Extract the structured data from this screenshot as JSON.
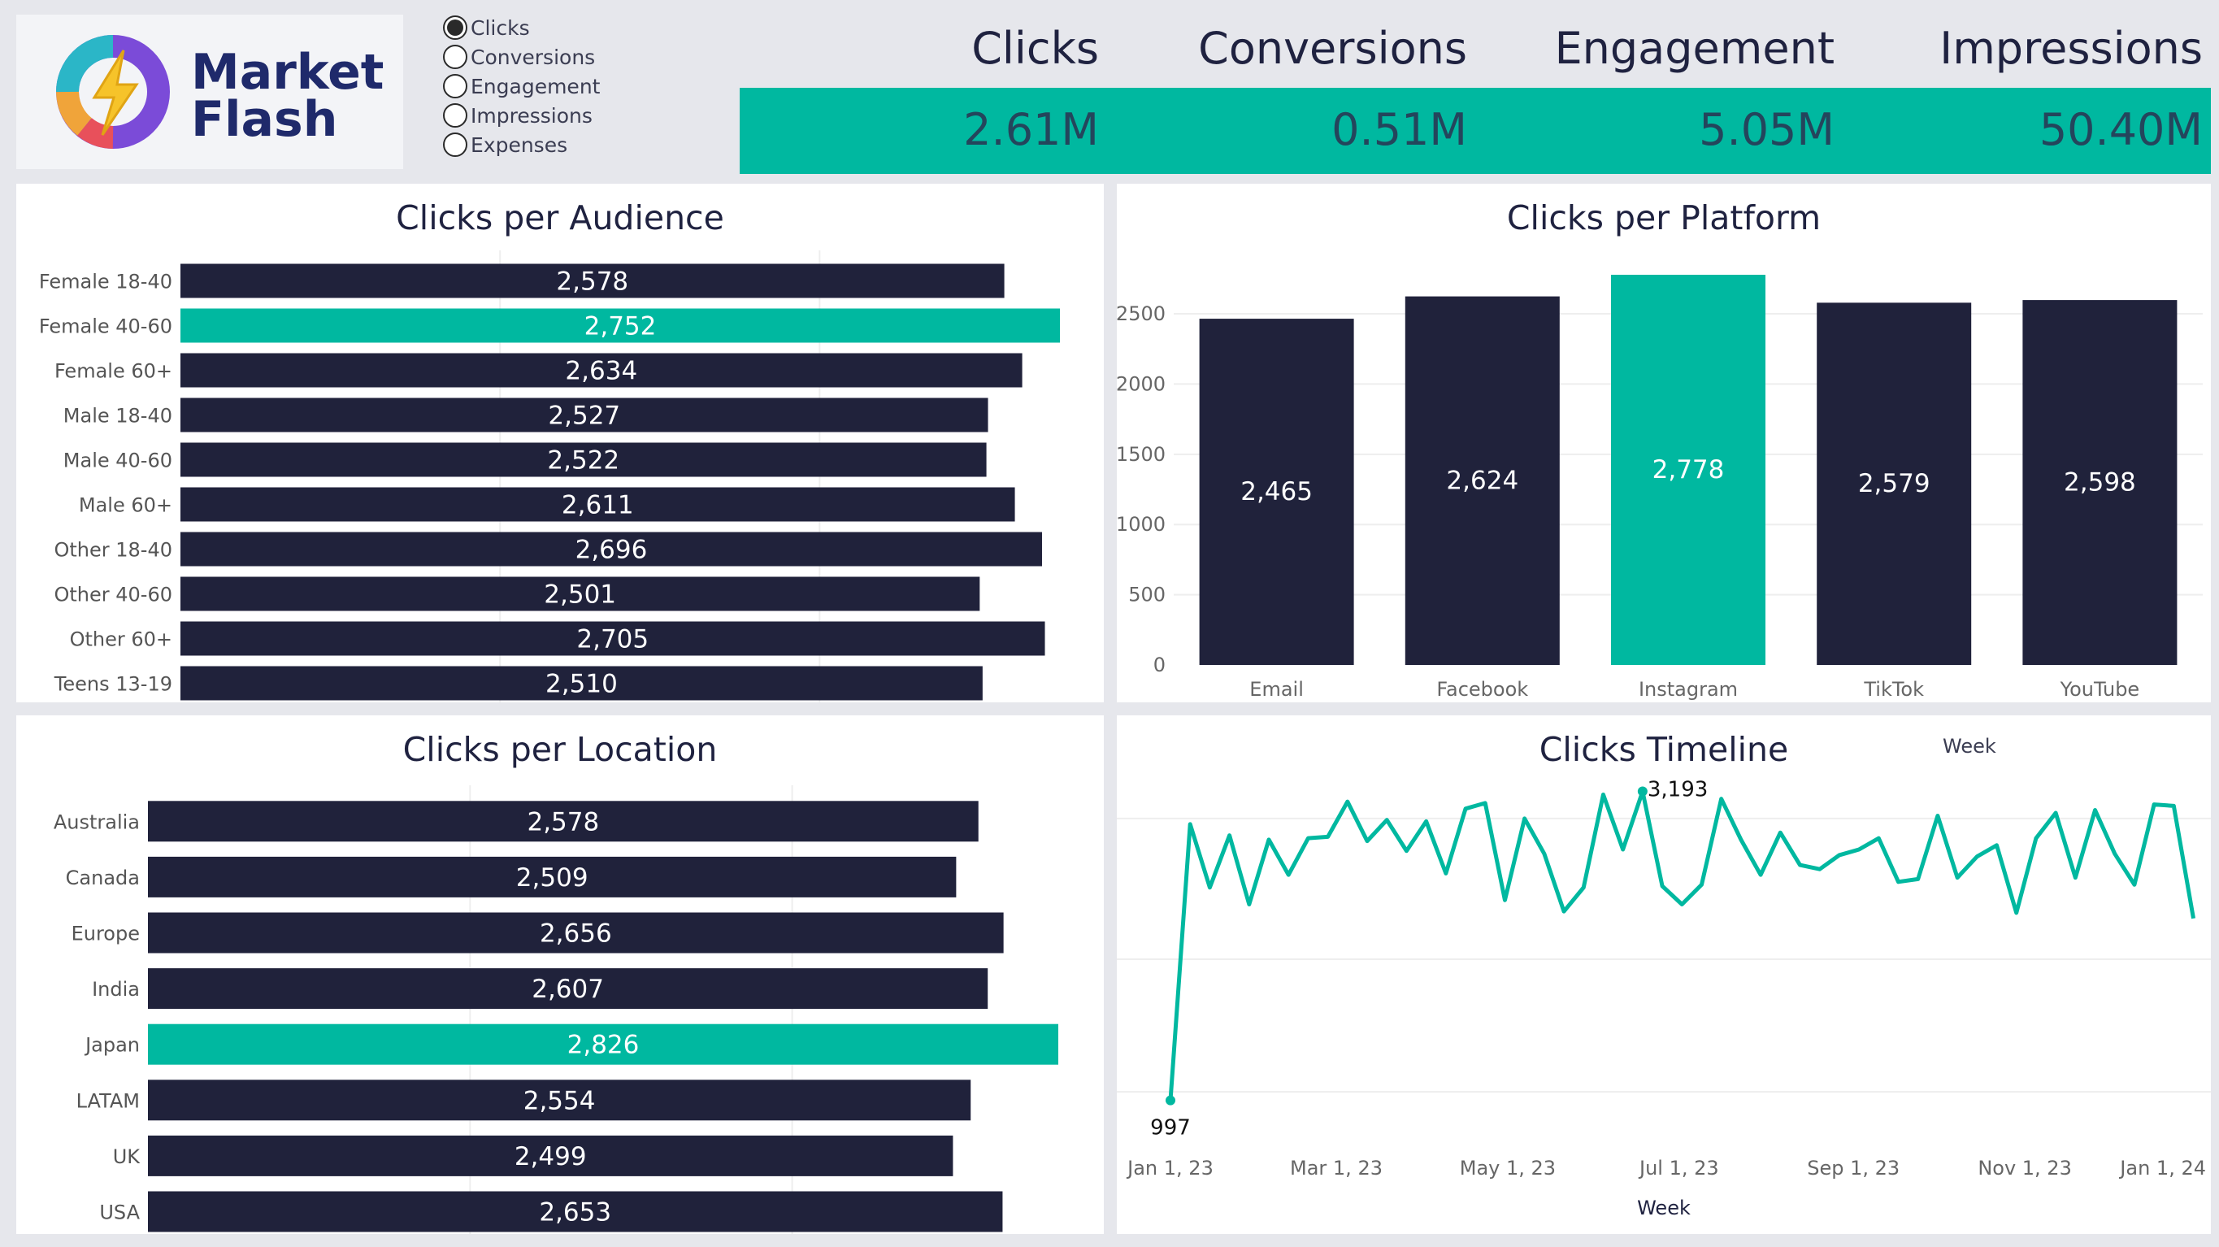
{
  "brand": {
    "line1": "Market",
    "line2": "Flash"
  },
  "metric_selector": {
    "options": [
      "Clicks",
      "Conversions",
      "Engagement",
      "Impressions",
      "Expenses"
    ],
    "selected": "Clicks"
  },
  "kpis": [
    {
      "label": "Clicks",
      "value": "2.61M"
    },
    {
      "label": "Conversions",
      "value": "0.51M"
    },
    {
      "label": "Engagement",
      "value": "5.05M"
    },
    {
      "label": "Impressions",
      "value": "50.40M"
    }
  ],
  "colors": {
    "bar": "#20223b",
    "highlight": "#00b8a0",
    "line": "#00b8a0"
  },
  "chart_data": [
    {
      "type": "bar",
      "orientation": "horizontal",
      "title": "Clicks per Audience",
      "categories": [
        "Female 18-40",
        "Female 40-60",
        "Female 60+",
        "Male 18-40",
        "Male 40-60",
        "Male 60+",
        "Other 18-40",
        "Other 40-60",
        "Other 60+",
        "Teens 13-19"
      ],
      "values": [
        2578,
        2752,
        2634,
        2527,
        2522,
        2611,
        2696,
        2501,
        2705,
        2510
      ],
      "labels": [
        "2,578",
        "2,752",
        "2,634",
        "2,527",
        "2,522",
        "2,611",
        "2,696",
        "2,501",
        "2,705",
        "2,510"
      ],
      "highlight": "Female 40-60"
    },
    {
      "type": "bar",
      "title": "Clicks per Platform",
      "categories": [
        "Email",
        "Facebook",
        "Instagram",
        "TikTok",
        "YouTube"
      ],
      "values": [
        2465,
        2624,
        2778,
        2579,
        2598
      ],
      "labels": [
        "2,465",
        "2,624",
        "2,778",
        "2,579",
        "2,598"
      ],
      "yticks": [
        "0",
        "500",
        "1000",
        "1500",
        "2000",
        "2500"
      ],
      "ylim": [
        0,
        2778
      ],
      "highlight": "Instagram"
    },
    {
      "type": "bar",
      "orientation": "horizontal",
      "title": "Clicks per Location",
      "categories": [
        "Australia",
        "Canada",
        "Europe",
        "India",
        "Japan",
        "LATAM",
        "UK",
        "USA"
      ],
      "values": [
        2578,
        2509,
        2656,
        2607,
        2826,
        2554,
        2499,
        2653
      ],
      "labels": [
        "2,578",
        "2,509",
        "2,656",
        "2,607",
        "2,826",
        "2,554",
        "2,499",
        "2,653"
      ],
      "highlight": "Japan"
    },
    {
      "type": "line",
      "title": "Clicks Timeline",
      "legend_title": "Week",
      "xlabel": "Week",
      "x_ticks": [
        "Jan 1, 23",
        "Mar 1, 23",
        "May 1, 23",
        "Jul 1, 23",
        "Sep 1, 23",
        "Nov 1, 23",
        "Jan 1, 24"
      ],
      "x": [
        "2023-01-01",
        "2023-01-08",
        "2023-01-15",
        "2023-01-22",
        "2023-01-29",
        "2023-02-05",
        "2023-02-12",
        "2023-02-19",
        "2023-02-26",
        "2023-03-05",
        "2023-03-12",
        "2023-03-19",
        "2023-03-26",
        "2023-04-02",
        "2023-04-09",
        "2023-04-16",
        "2023-04-23",
        "2023-04-30",
        "2023-05-07",
        "2023-05-14",
        "2023-05-21",
        "2023-05-28",
        "2023-06-04",
        "2023-06-11",
        "2023-06-18",
        "2023-06-25",
        "2023-07-02",
        "2023-07-09",
        "2023-07-16",
        "2023-07-23",
        "2023-07-30",
        "2023-08-06",
        "2023-08-13",
        "2023-08-20",
        "2023-08-27",
        "2023-09-03",
        "2023-09-10",
        "2023-09-17",
        "2023-09-24",
        "2023-10-01",
        "2023-10-08",
        "2023-10-15",
        "2023-10-22",
        "2023-10-29",
        "2023-11-05",
        "2023-11-12",
        "2023-11-19",
        "2023-11-26",
        "2023-12-03",
        "2023-12-10",
        "2023-12-17",
        "2023-12-24",
        "2023-12-31"
      ],
      "values": [
        997,
        2960,
        2510,
        2880,
        2390,
        2850,
        2600,
        2860,
        2870,
        3120,
        2840,
        2990,
        2770,
        2980,
        2610,
        3070,
        3110,
        2420,
        3000,
        2750,
        2340,
        2510,
        3170,
        2780,
        3193,
        2520,
        2390,
        2530,
        3140,
        2850,
        2600,
        2900,
        2670,
        2640,
        2740,
        2780,
        2860,
        2550,
        2570,
        3020,
        2580,
        2730,
        2810,
        2330,
        2860,
        3040,
        2580,
        3060,
        2750,
        2530,
        3100,
        3090,
        2290
      ],
      "annotations": [
        {
          "label": "997",
          "index": 0
        },
        {
          "label": "3,193",
          "index": 24
        }
      ]
    }
  ]
}
